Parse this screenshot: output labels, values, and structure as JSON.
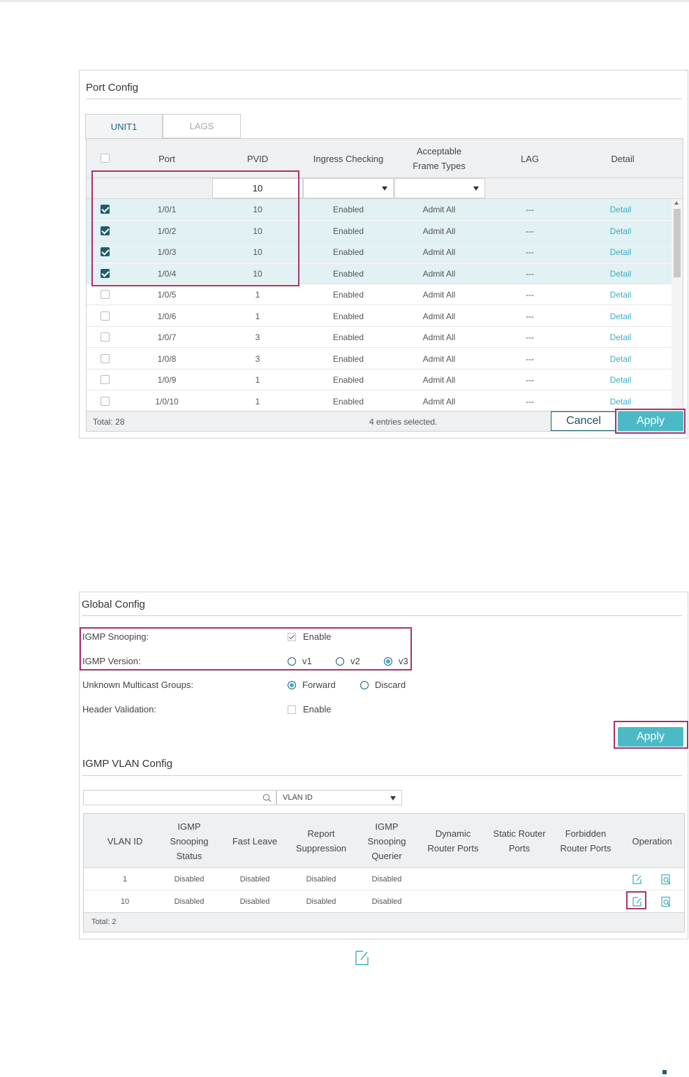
{
  "port_config": {
    "title": "Port Config",
    "tabs": [
      {
        "label": "UNIT1",
        "active": true
      },
      {
        "label": "LAGS",
        "active": false
      }
    ],
    "columns": {
      "port": "Port",
      "pvid": "PVID",
      "ingress": "Ingress Checking",
      "frame_types": "Acceptable Frame Types",
      "lag": "LAG",
      "detail": "Detail"
    },
    "filter": {
      "pvid_value": "10",
      "ingress_value": "",
      "frame_types_value": ""
    },
    "rows": [
      {
        "port": "1/0/1",
        "pvid": "10",
        "ingress": "Enabled",
        "frame_types": "Admit All",
        "lag": "---",
        "detail": "Detail",
        "checked": true
      },
      {
        "port": "1/0/2",
        "pvid": "10",
        "ingress": "Enabled",
        "frame_types": "Admit All",
        "lag": "---",
        "detail": "Detail",
        "checked": true
      },
      {
        "port": "1/0/3",
        "pvid": "10",
        "ingress": "Enabled",
        "frame_types": "Admit All",
        "lag": "---",
        "detail": "Detail",
        "checked": true
      },
      {
        "port": "1/0/4",
        "pvid": "10",
        "ingress": "Enabled",
        "frame_types": "Admit All",
        "lag": "---",
        "detail": "Detail",
        "checked": true
      },
      {
        "port": "1/0/5",
        "pvid": "1",
        "ingress": "Enabled",
        "frame_types": "Admit All",
        "lag": "---",
        "detail": "Detail",
        "checked": false
      },
      {
        "port": "1/0/6",
        "pvid": "1",
        "ingress": "Enabled",
        "frame_types": "Admit All",
        "lag": "---",
        "detail": "Detail",
        "checked": false
      },
      {
        "port": "1/0/7",
        "pvid": "3",
        "ingress": "Enabled",
        "frame_types": "Admit All",
        "lag": "---",
        "detail": "Detail",
        "checked": false
      },
      {
        "port": "1/0/8",
        "pvid": "3",
        "ingress": "Enabled",
        "frame_types": "Admit All",
        "lag": "---",
        "detail": "Detail",
        "checked": false
      },
      {
        "port": "1/0/9",
        "pvid": "1",
        "ingress": "Enabled",
        "frame_types": "Admit All",
        "lag": "---",
        "detail": "Detail",
        "checked": false
      },
      {
        "port": "1/0/10",
        "pvid": "1",
        "ingress": "Enabled",
        "frame_types": "Admit All",
        "lag": "---",
        "detail": "Detail",
        "checked": false
      }
    ],
    "footer": {
      "total": "Total: 28",
      "selected": "4 entries selected."
    },
    "cancel_label": "Cancel",
    "apply_label": "Apply"
  },
  "global_config": {
    "title": "Global Config",
    "igmp_snooping_label": "IGMP Snooping:",
    "igmp_snooping_option": "Enable",
    "igmp_snooping_checked": true,
    "igmp_version_label": "IGMP Version:",
    "igmp_versions": [
      {
        "label": "v1",
        "selected": false
      },
      {
        "label": "v2",
        "selected": false
      },
      {
        "label": "v3",
        "selected": true
      }
    ],
    "unknown_multicast_label": "Unknown Multicast Groups:",
    "unknown_multicast_options": [
      {
        "label": "Forward",
        "selected": true
      },
      {
        "label": "Discard",
        "selected": false
      }
    ],
    "header_validation_label": "Header Validation:",
    "header_validation_option": "Enable",
    "header_validation_checked": false,
    "apply_label": "Apply"
  },
  "igmp_vlan_config": {
    "title": "IGMP VLAN Config",
    "search_value": "",
    "search_field": "VLAN ID",
    "columns": {
      "vlan_id": "VLAN ID",
      "snooping_status": "IGMP Snooping Status",
      "fast_leave": "Fast Leave",
      "report_suppression": "Report Suppression",
      "snooping_querier": "IGMP Snooping Querier",
      "dynamic_router_ports": "Dynamic Router Ports",
      "static_router_ports": "Static Router Ports",
      "forbidden_router_ports": "Forbidden Router Ports",
      "operation": "Operation"
    },
    "rows": [
      {
        "vlan_id": "1",
        "snooping_status": "Disabled",
        "fast_leave": "Disabled",
        "report_suppression": "Disabled",
        "snooping_querier": "Disabled",
        "dynamic_router_ports": "",
        "static_router_ports": "",
        "forbidden_router_ports": ""
      },
      {
        "vlan_id": "10",
        "snooping_status": "Disabled",
        "fast_leave": "Disabled",
        "report_suppression": "Disabled",
        "snooping_querier": "Disabled",
        "dynamic_router_ports": "",
        "static_router_ports": "",
        "forbidden_router_ports": ""
      }
    ],
    "footer_total": "Total: 2"
  },
  "colors": {
    "accent": "#4bbac6",
    "link": "#3aadc0",
    "dark_teal": "#1e5d6f",
    "highlight_frame": "#a8326c",
    "selected_row": "#e1f1f4"
  },
  "icons": [
    "edit-icon",
    "view-detail-icon",
    "search-icon",
    "dropdown-caret-icon"
  ]
}
